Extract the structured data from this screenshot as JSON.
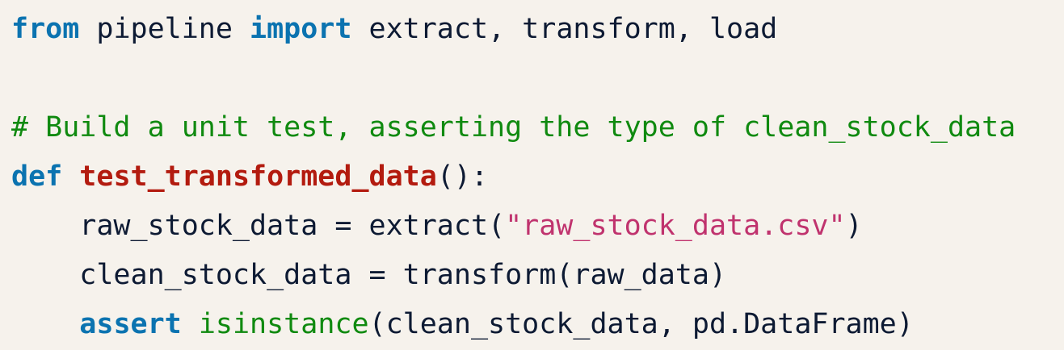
{
  "editor": {
    "background": "#f6f2ec",
    "colors": {
      "plain": "#0d1a33",
      "keyword": "#0b73b0",
      "function_name": "#b31b0f",
      "comment": "#108a10",
      "string": "#c0336e",
      "builtin": "#108a10"
    },
    "lines": [
      [
        {
          "text": "from",
          "type": "keyword"
        },
        {
          "text": " pipeline ",
          "type": "plain"
        },
        {
          "text": "import",
          "type": "keyword"
        },
        {
          "text": " extract, transform, load",
          "type": "plain"
        }
      ],
      [],
      [
        {
          "text": "# Build a unit test, asserting the type of clean_stock_data",
          "type": "comment"
        }
      ],
      [
        {
          "text": "def",
          "type": "keyword"
        },
        {
          "text": " ",
          "type": "plain"
        },
        {
          "text": "test_transformed_data",
          "type": "function_name"
        },
        {
          "text": "():",
          "type": "plain"
        }
      ],
      [
        {
          "text": "    raw_stock_data = extract(",
          "type": "plain"
        },
        {
          "text": "\"raw_stock_data.csv\"",
          "type": "string"
        },
        {
          "text": ")",
          "type": "plain"
        }
      ],
      [
        {
          "text": "    clean_stock_data = transform(raw_data)",
          "type": "plain"
        }
      ],
      [
        {
          "text": "    ",
          "type": "plain"
        },
        {
          "text": "assert",
          "type": "keyword"
        },
        {
          "text": " ",
          "type": "plain"
        },
        {
          "text": "isinstance",
          "type": "builtin"
        },
        {
          "text": "(clean_stock_data, pd.DataFrame)",
          "type": "plain"
        }
      ]
    ]
  }
}
